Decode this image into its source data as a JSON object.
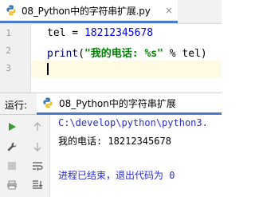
{
  "editor": {
    "tab_title": "08_Python中的字符串扩展.py",
    "close_glyph": "×",
    "line_numbers": [
      "1",
      "2",
      "3"
    ],
    "line1": {
      "var": "tel",
      "op": " = ",
      "num": "18212345678"
    },
    "line2": {
      "fn": "print",
      "open": "(",
      "str": "\"我的电话: %s\"",
      "mid": " % tel)"
    }
  },
  "run_panel": {
    "label": "运行:",
    "tab_title": "08_Python中的字符串扩展",
    "console": {
      "path_line": "C:\\develop\\python\\python3.",
      "output_line": "我的电话: 18212345678",
      "exit_line": "进程已结束，退出代码为 0"
    },
    "tools": [
      "run-icon",
      "wrench-icon",
      "up-arrow-icon",
      "down-arrow-icon",
      "stop-icon",
      "soft-wrap-icon",
      "scroll-to-end-icon",
      "print-icon"
    ]
  },
  "colors": {
    "accent": "#4a7ac9",
    "string": "#008000",
    "console_path": "#2b2bd6",
    "current_line": "#fffae3"
  }
}
